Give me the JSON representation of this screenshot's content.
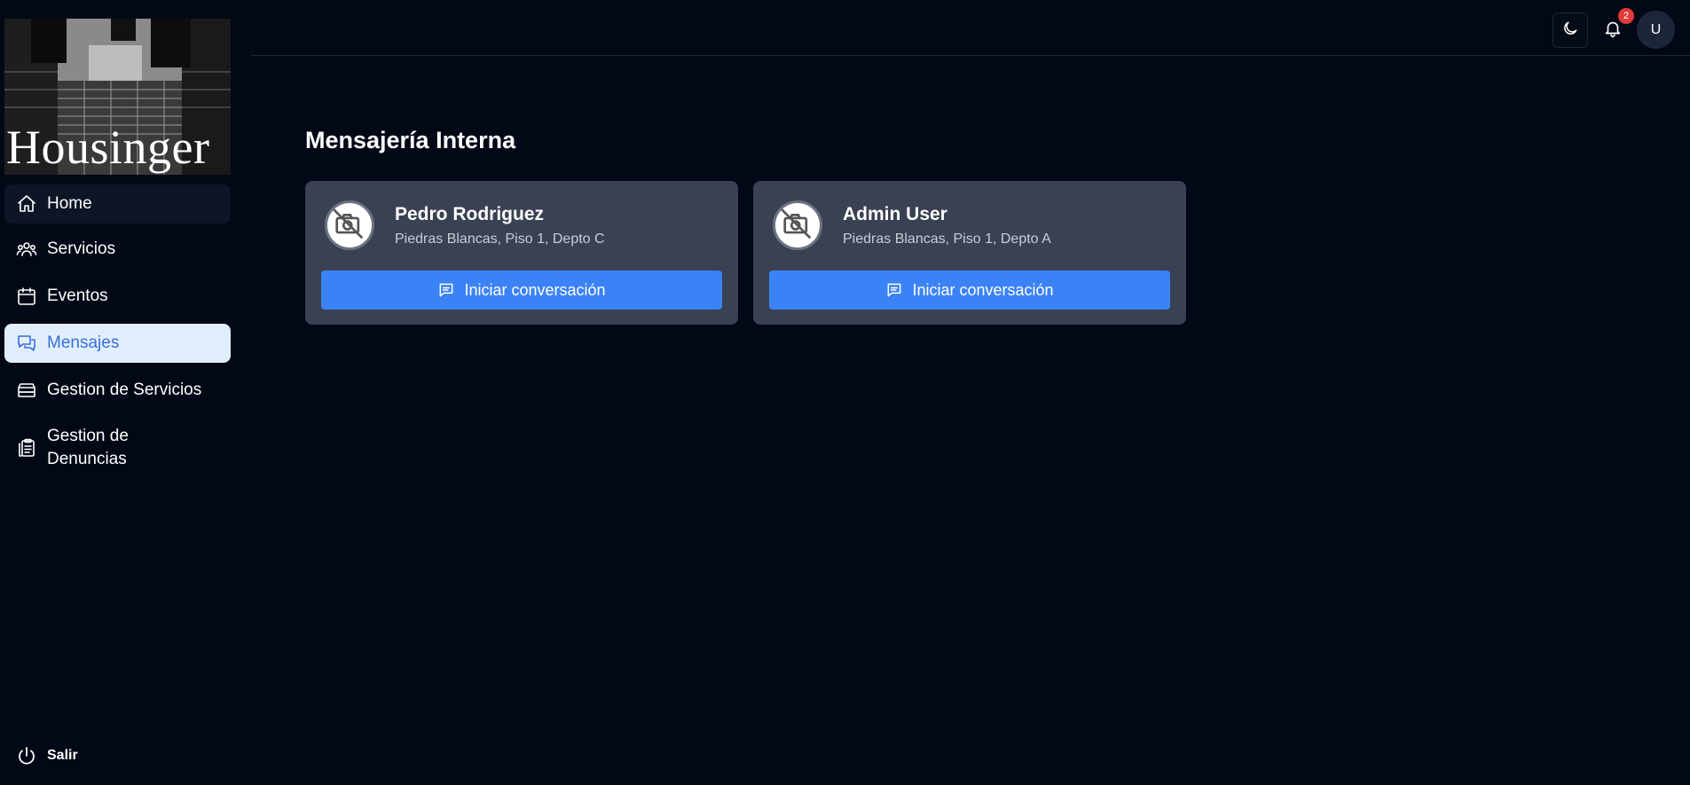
{
  "app": {
    "logo_text": "Housinger"
  },
  "sidebar": {
    "items": [
      {
        "label": "Home",
        "icon": "home-icon"
      },
      {
        "label": "Servicios",
        "icon": "users-icon"
      },
      {
        "label": "Eventos",
        "icon": "calendar-icon"
      },
      {
        "label": "Mensajes",
        "icon": "chat-bubbles-icon",
        "active": true
      },
      {
        "label": "Gestion de Servicios",
        "icon": "server-icon"
      },
      {
        "label": "Gestion de Denuncias",
        "icon": "clipboard-icon"
      }
    ],
    "logout_label": "Salir"
  },
  "header": {
    "notification_count": "2",
    "avatar_initial": "U"
  },
  "main": {
    "title": "Mensajería Interna",
    "contacts": [
      {
        "name": "Pedro Rodriguez",
        "address": "Piedras Blancas, Piso 1, Depto C",
        "button_label": "Iniciar conversación"
      },
      {
        "name": "Admin User",
        "address": "Piedras Blancas, Piso 1, Depto A",
        "button_label": "Iniciar conversación"
      }
    ]
  },
  "colors": {
    "background": "#030816",
    "card": "#394152",
    "accent": "#3b82f6",
    "active_nav_bg": "#e0eefe",
    "active_nav_text": "#3b6fd8",
    "badge": "#e23a3a"
  }
}
